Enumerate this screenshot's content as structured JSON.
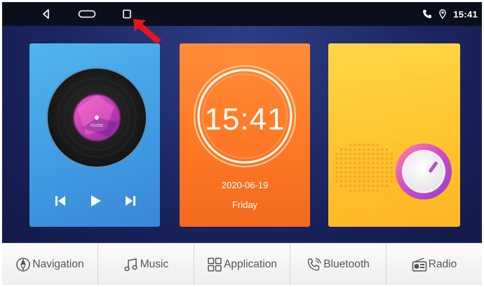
{
  "statusbar": {
    "buttons": [
      {
        "name": "back",
        "icon": "back-triangle-icon"
      },
      {
        "name": "home",
        "icon": "home-pill-icon"
      },
      {
        "name": "recent",
        "icon": "recent-apps-square-icon"
      }
    ],
    "indicators": [
      "phone-icon",
      "location-pin-icon"
    ],
    "time": "15:41"
  },
  "cards": {
    "music": {
      "disc_label": "music",
      "controls": [
        "previous-icon",
        "play-icon",
        "next-icon"
      ],
      "colors": {
        "top": "#4fb6ee",
        "bottom": "#3a86d7"
      }
    },
    "clock": {
      "time": "15:41",
      "date": "2020-06-19",
      "day": "Friday",
      "colors": {
        "top": "#ff8d3a",
        "bottom": "#f46a1e"
      }
    },
    "radio": {
      "icons": [
        "speaker-grille-icon",
        "volume-knob-icon"
      ],
      "colors": {
        "top": "#ffd648",
        "bottom": "#ffb524",
        "knob": "#c64cc1"
      }
    }
  },
  "dock": {
    "items": [
      {
        "label": "Navigation",
        "icon": "compass-icon"
      },
      {
        "label": "Music",
        "icon": "music-note-icon"
      },
      {
        "label": "Application",
        "icon": "app-grid-icon"
      },
      {
        "label": "Bluetooth",
        "icon": "bluetooth-phone-icon"
      },
      {
        "label": "Radio",
        "icon": "radio-icon"
      }
    ]
  },
  "annotation": {
    "icon": "red-arrow-icon",
    "color": "#e8141a"
  }
}
